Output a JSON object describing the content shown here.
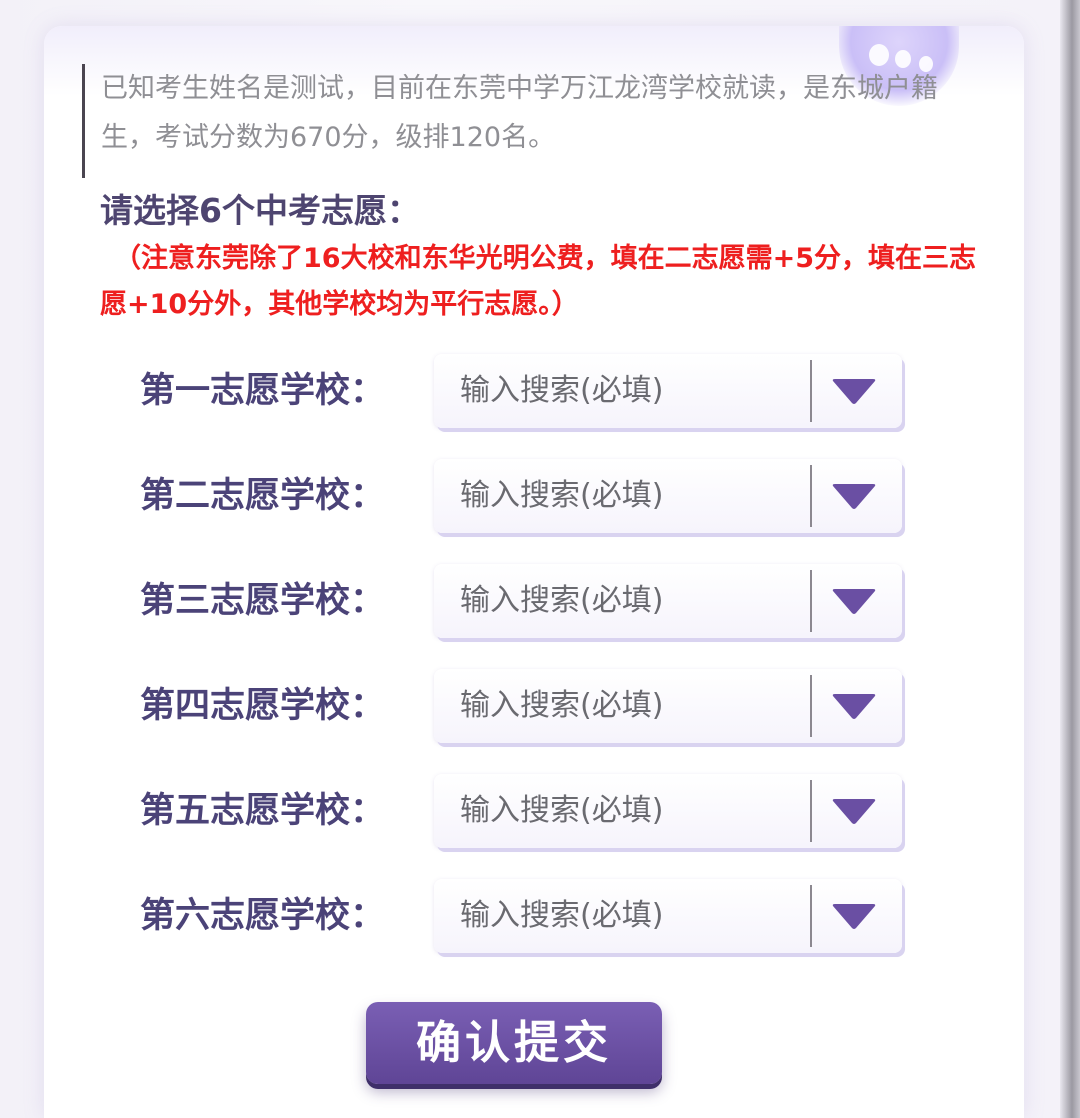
{
  "intro": {
    "text": "已知考生姓名是测试，目前在东莞中学万江龙湾学校就读，是东城户籍生，考试分数为670分，级排120名。"
  },
  "form": {
    "title": "请选择6个中考志愿：",
    "notice": "（注意东莞除了16大校和东华光明公费，填在二志愿需+5分，填在三志愿+10分外，其他学校均为平行志愿。）",
    "rows": [
      {
        "label": "第一志愿学校：",
        "placeholder": "输入搜索(必填)"
      },
      {
        "label": "第二志愿学校：",
        "placeholder": "输入搜索(必填)"
      },
      {
        "label": "第三志愿学校：",
        "placeholder": "输入搜索(必填)"
      },
      {
        "label": "第四志愿学校：",
        "placeholder": "输入搜索(必填)"
      },
      {
        "label": "第五志愿学校：",
        "placeholder": "输入搜索(必填)"
      },
      {
        "label": "第六志愿学校：",
        "placeholder": "输入搜索(必填)"
      }
    ],
    "submit_label": "确认提交"
  },
  "icons": {
    "dropdown": "triangle-down-icon",
    "decoration": "bubble-icon"
  },
  "colors": {
    "accent": "#6a4fa3",
    "label": "#4b4378",
    "notice": "#ee1f1f",
    "intro_text": "#8f8f94"
  }
}
